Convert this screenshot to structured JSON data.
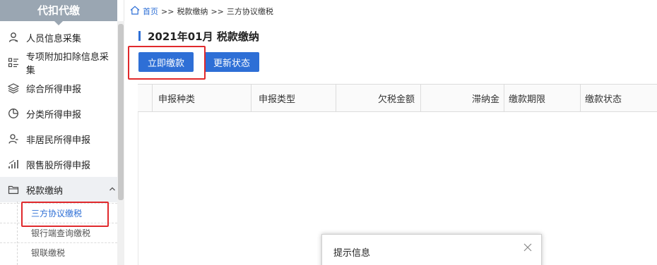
{
  "sidebar": {
    "header": "代扣代缴",
    "items": [
      {
        "label": "人员信息采集",
        "icon": "person-icon"
      },
      {
        "label": "专项附加扣除信息采集",
        "icon": "list-icon"
      },
      {
        "label": "综合所得申报",
        "icon": "layers-icon"
      },
      {
        "label": "分类所得申报",
        "icon": "pie-chart-icon"
      },
      {
        "label": "非居民所得申报",
        "icon": "person-outline-icon"
      },
      {
        "label": "限售股所得申报",
        "icon": "bar-chart-icon"
      },
      {
        "label": "税款缴纳",
        "icon": "folder-icon",
        "expanded": true
      }
    ],
    "subitems": [
      {
        "label": "三方协议缴税",
        "current": true
      },
      {
        "label": "银行端查询缴税"
      },
      {
        "label": "银联缴税"
      }
    ]
  },
  "breadcrumb": {
    "home": "首页",
    "sep1": ">>",
    "level2": "税款缴纳",
    "sep2": ">>",
    "level3": "三方协议缴税"
  },
  "page": {
    "title": "2021年01月  税款缴纳",
    "accent_color": "#2e6fd6",
    "highlight_color": "#e0292c"
  },
  "actions": {
    "pay_now": "立即缴款",
    "refresh_status": "更新状态"
  },
  "table": {
    "columns": [
      "申报种类",
      "申报类型",
      "欠税金额",
      "滞纳金",
      "缴款期限",
      "缴款状态"
    ],
    "rows": []
  },
  "dialog": {
    "title": "提示信息"
  }
}
